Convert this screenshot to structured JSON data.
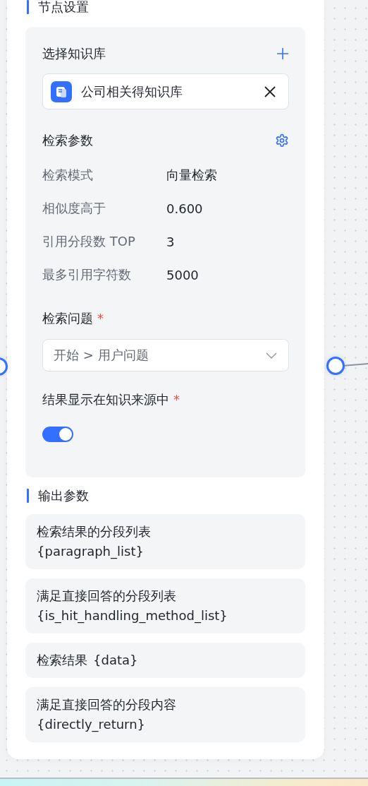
{
  "node": {
    "title": "节点设置",
    "knowledge": {
      "label": "选择知识库",
      "items": [
        {
          "name": "公司相关得知识库"
        }
      ]
    },
    "search_params": {
      "label": "检索参数",
      "rows": [
        {
          "label": "检索模式",
          "value": "向量检索"
        },
        {
          "label": "相似度高于",
          "value": "0.600"
        },
        {
          "label": "引用分段数 TOP",
          "value": "3"
        },
        {
          "label": "最多引用字符数",
          "value": "5000"
        }
      ]
    },
    "question": {
      "label": "检索问题",
      "required_mark": "*",
      "value": "开始 > 用户问题"
    },
    "show_in_source": {
      "label": "结果显示在知识来源中",
      "required_mark": "*",
      "on": true
    },
    "output": {
      "title": "输出参数",
      "items": [
        {
          "label": "检索结果的分段列表",
          "variable": "{paragraph_list}",
          "stacked": true
        },
        {
          "label": "满足直接回答的分段列表",
          "variable": "{is_hit_handling_method_list}",
          "stacked": true
        },
        {
          "label": "检索结果",
          "variable": "{data}",
          "stacked": false
        },
        {
          "label": "满足直接回答的分段内容",
          "variable": "{directly_return}",
          "stacked": true
        }
      ]
    }
  }
}
